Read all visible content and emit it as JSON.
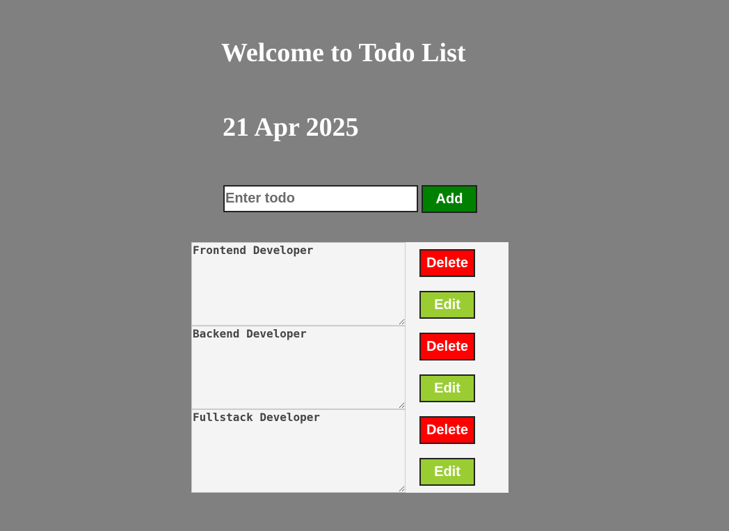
{
  "header": {
    "title": "Welcome to Todo List",
    "date": "21 Apr 2025"
  },
  "form": {
    "input_value": "",
    "input_placeholder": "Enter todo",
    "add_label": "Add"
  },
  "todos": [
    {
      "text": "Frontend Developer",
      "delete_label": "Delete",
      "edit_label": "Edit"
    },
    {
      "text": "Backend Developer",
      "delete_label": "Delete",
      "edit_label": "Edit"
    },
    {
      "text": "Fullstack Developer",
      "delete_label": "Delete",
      "edit_label": "Edit"
    }
  ],
  "colors": {
    "background": "#808080",
    "add": "#008000",
    "delete": "#ff0000",
    "edit": "#9acd32",
    "list_bg": "#f4f4f4"
  }
}
